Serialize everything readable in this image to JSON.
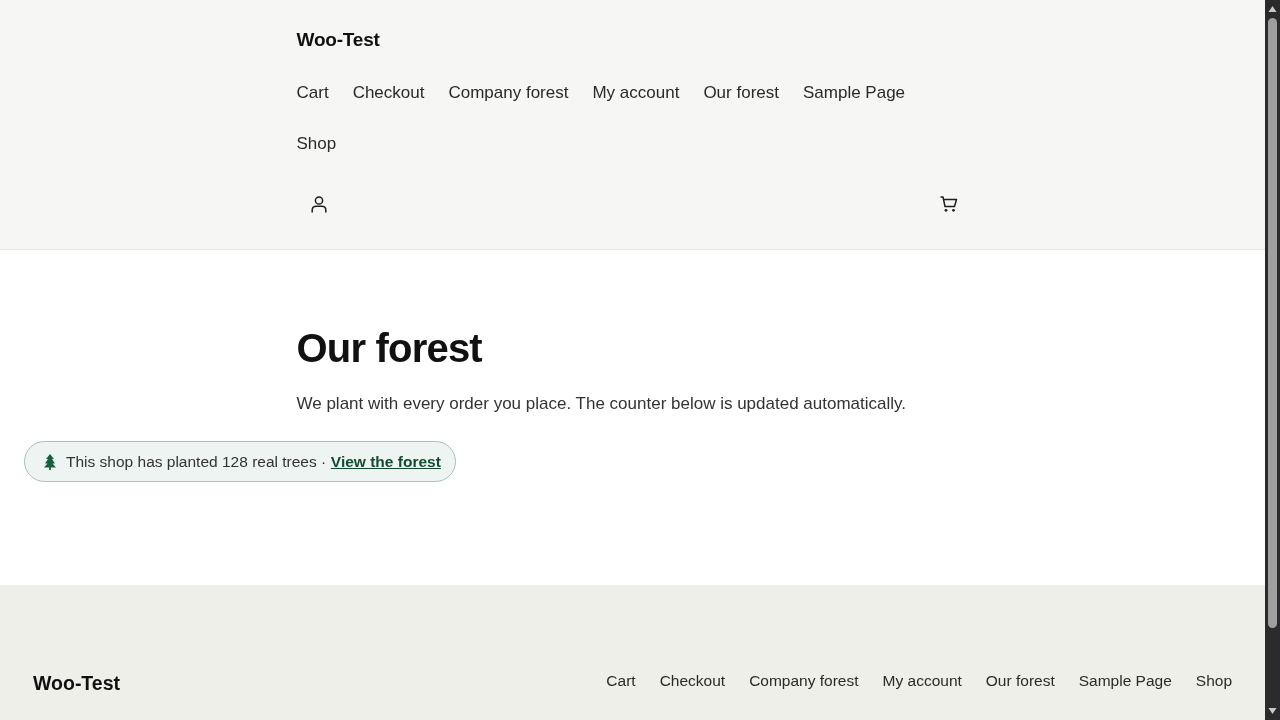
{
  "header": {
    "site_title": "Woo-Test",
    "nav": [
      "Cart",
      "Checkout",
      "Company forest",
      "My account",
      "Our forest",
      "Sample Page",
      "Shop"
    ]
  },
  "main": {
    "title": "Our forest",
    "intro": "We plant with every order you place. The counter below is updated automatically.",
    "tree_counter": {
      "text": "This shop has planted 128 real trees ·",
      "link": "View the forest"
    }
  },
  "footer": {
    "site_title": "Woo-Test",
    "nav": [
      "Cart",
      "Checkout",
      "Company forest",
      "My account",
      "Our forest",
      "Sample Page",
      "Shop"
    ]
  }
}
